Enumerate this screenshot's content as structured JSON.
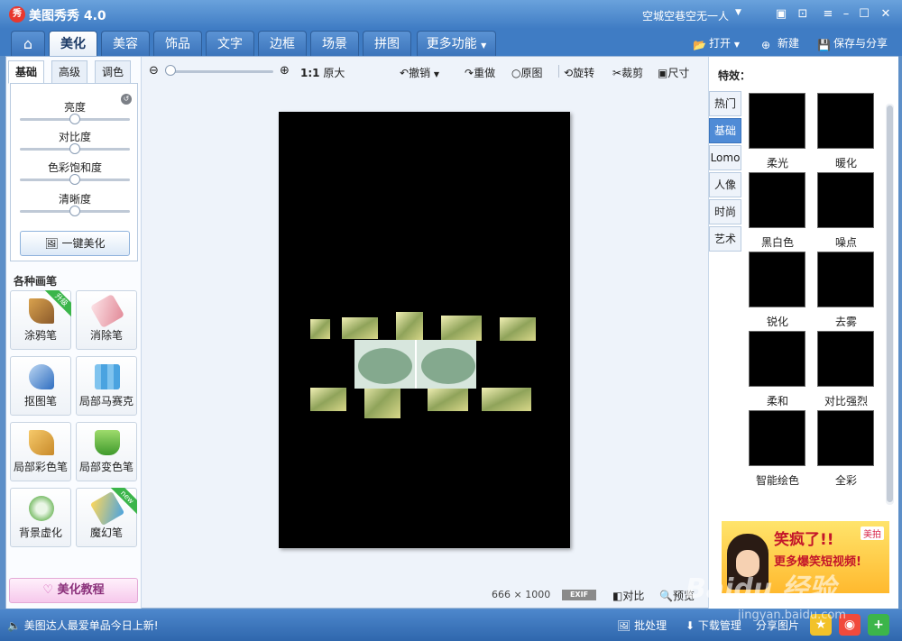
{
  "titlebar": {
    "logo": "秀",
    "title": "美图秀秀 4.0",
    "user": "空城空巷空无一人"
  },
  "nav": {
    "tabs": [
      "美化",
      "美容",
      "饰品",
      "文字",
      "边框",
      "场景",
      "拼图",
      "更多功能"
    ],
    "open": "打开",
    "new": "新建",
    "save_share": "保存与分享"
  },
  "left": {
    "subtabs": [
      "基础",
      "高级",
      "调色"
    ],
    "sliders": [
      {
        "label": "亮度",
        "level": 0.5
      },
      {
        "label": "对比度",
        "level": 0.5
      },
      {
        "label": "色彩饱和度",
        "level": 0.5
      },
      {
        "label": "清晰度",
        "level": 0.5
      }
    ],
    "one_click": "一键美化",
    "brushes_title": "各种画笔",
    "brushes": [
      {
        "label": "涂鸦笔",
        "badge": "升级"
      },
      {
        "label": "消除笔",
        "badge": ""
      },
      {
        "label": "抠图笔",
        "badge": ""
      },
      {
        "label": "局部马赛克",
        "badge": ""
      },
      {
        "label": "局部彩色笔",
        "badge": ""
      },
      {
        "label": "局部变色笔",
        "badge": ""
      },
      {
        "label": "背景虚化",
        "badge": ""
      },
      {
        "label": "魔幻笔",
        "badge": "new"
      }
    ],
    "tutorial": "美化教程"
  },
  "toolbar": {
    "ratio": "1:1",
    "original_size": "原大",
    "undo": "撤销",
    "redo": "重做",
    "original": "原图",
    "rotate": "旋转",
    "crop": "裁剪",
    "size": "尺寸"
  },
  "canvas": {
    "width": "666",
    "x": "×",
    "height": "1000",
    "exif": "EXIF",
    "compare": "对比",
    "preview": "预览"
  },
  "right": {
    "title": "特效：",
    "tabs": [
      "热门",
      "基础",
      "Lomo",
      "人像",
      "时尚",
      "艺术"
    ],
    "effects": [
      "柔光",
      "暖化",
      "黑白色",
      "噪点",
      "锐化",
      "去雾",
      "柔和",
      "对比强烈",
      "智能绘色",
      "全彩"
    ],
    "ad_line1": "笑疯了!!",
    "ad_line2": "更多爆笑短视频!",
    "ad_brand": "美拍"
  },
  "status": {
    "message": "美图达人最爱单品今日上新!",
    "batch": "批处理",
    "download": "下载管理",
    "share": "分享图片"
  },
  "watermark": {
    "brand": "Baidu 经验",
    "url": "jingyan.baidu.com"
  },
  "colors": {
    "primary": "#3f7cc4",
    "active_tab": "#4f8bd6",
    "canvas_bg": "#000000"
  }
}
